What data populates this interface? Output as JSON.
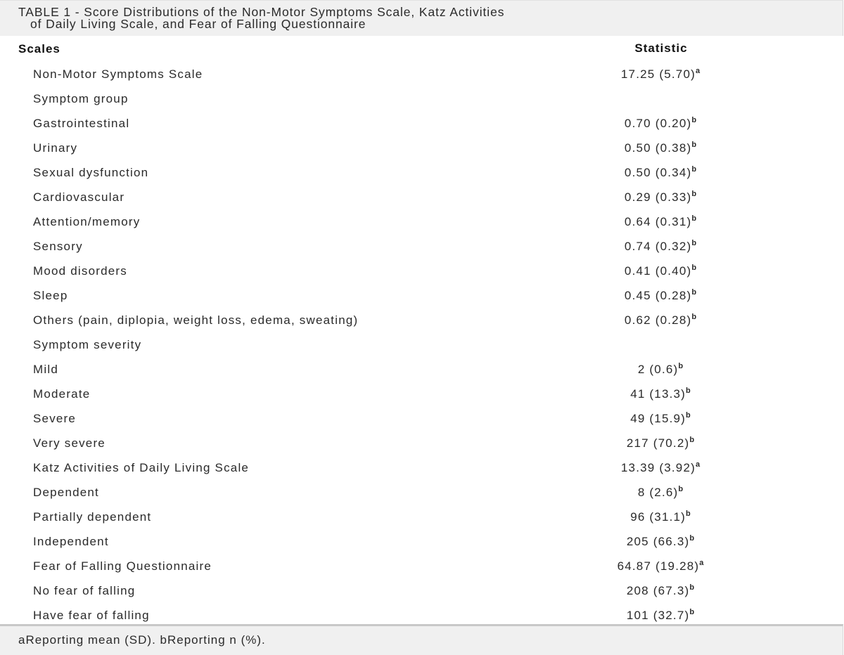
{
  "caption": {
    "line1": "TABLE 1 - Score Distributions of the Non-Motor Symptoms Scale, Katz Activities",
    "line2": "of Daily Living Scale, and Fear of Falling Questionnaire"
  },
  "table": {
    "headers": [
      "Scales",
      "Statistic"
    ],
    "rows": [
      {
        "label": "Non-Motor Symptoms Scale",
        "value": "17.25 (5.70)",
        "note": "a"
      },
      {
        "label": "Symptom group",
        "value": "",
        "note": ""
      },
      {
        "label": "Gastrointestinal",
        "value": "0.70 (0.20)",
        "note": "b"
      },
      {
        "label": "Urinary",
        "value": "0.50 (0.38)",
        "note": "b"
      },
      {
        "label": "Sexual dysfunction",
        "value": "0.50 (0.34)",
        "note": "b"
      },
      {
        "label": "Cardiovascular",
        "value": "0.29 (0.33)",
        "note": "b"
      },
      {
        "label": "Attention/memory",
        "value": "0.64 (0.31)",
        "note": "b"
      },
      {
        "label": "Sensory",
        "value": "0.74 (0.32)",
        "note": "b"
      },
      {
        "label": "Mood disorders",
        "value": "0.41 (0.40)",
        "note": "b"
      },
      {
        "label": "Sleep",
        "value": "0.45 (0.28)",
        "note": "b"
      },
      {
        "label": "Others (pain, diplopia, weight loss, edema, sweating)",
        "value": "0.62 (0.28)",
        "note": "b"
      },
      {
        "label": "Symptom severity",
        "value": "",
        "note": ""
      },
      {
        "label": "Mild",
        "value": "2 (0.6)",
        "note": "b"
      },
      {
        "label": "Moderate",
        "value": "41 (13.3)",
        "note": "b"
      },
      {
        "label": "Severe",
        "value": "49 (15.9)",
        "note": "b"
      },
      {
        "label": "Very severe",
        "value": "217 (70.2)",
        "note": "b"
      },
      {
        "label": "Katz Activities of Daily Living Scale",
        "value": "13.39 (3.92)",
        "note": "a"
      },
      {
        "label": "Dependent",
        "value": "8 (2.6)",
        "note": "b"
      },
      {
        "label": "Partially dependent",
        "value": "96 (31.1)",
        "note": "b"
      },
      {
        "label": "Independent",
        "value": "205 (66.3)",
        "note": "b"
      },
      {
        "label": "Fear of Falling Questionnaire",
        "value": "64.87 (19.28)",
        "note": "a"
      },
      {
        "label": "No fear of falling",
        "value": "208 (67.3)",
        "note": "b"
      },
      {
        "label": "Have fear of falling",
        "value": "101 (32.7)",
        "note": "b"
      }
    ]
  },
  "footer": {
    "note": "aReporting mean (SD). bReporting n (%)."
  }
}
